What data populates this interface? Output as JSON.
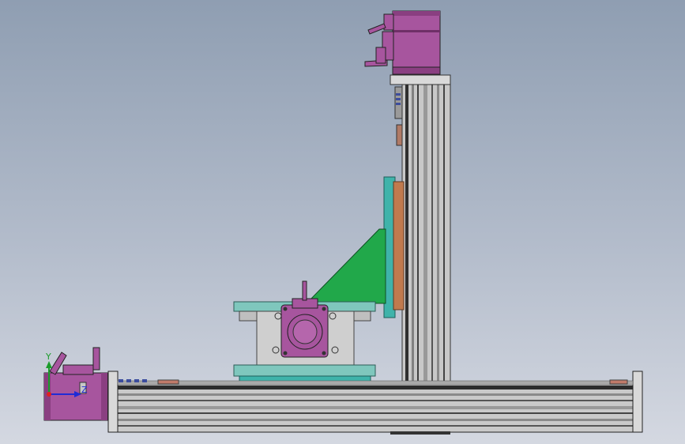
{
  "viewport": {
    "background_top": "#8f9eb2",
    "background_bottom": "#d4d8e1"
  },
  "colors": {
    "motor_body": "#a7559e",
    "motor_dark": "#7b3472",
    "rail_aluminum": "#c9c9c9",
    "rail_dark": "#2c2c2c",
    "carriage_teal": "#3fb3aa",
    "mount_teal": "#7fc7bd",
    "gusset_green": "#21a84a",
    "bracket_orange": "#c07a4e",
    "housing_gray": "#cfcfcf"
  },
  "triad": {
    "x_label": "",
    "y_label": "Y",
    "z_label": "Z",
    "x_color": "#e02020",
    "y_color": "#1b9c2b",
    "z_color": "#1f2bd6"
  },
  "assembly": {
    "parts": [
      "x-axis-rail",
      "x-axis-motor",
      "z-axis-column",
      "z-axis-motor",
      "vertical-carriage-plate",
      "support-gusset",
      "rotary-table",
      "rotary-motor"
    ]
  }
}
